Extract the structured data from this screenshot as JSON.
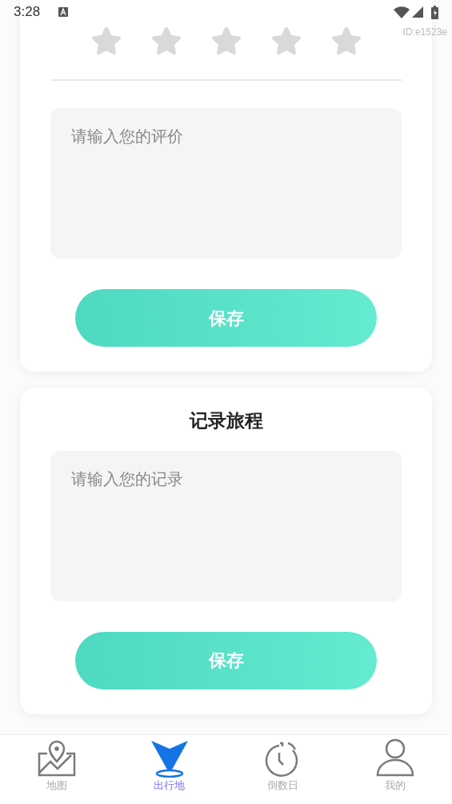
{
  "status_bar": {
    "time": "3:28",
    "overlay_id": "ID:e1523e"
  },
  "rating": {
    "stars": 0,
    "comment": {
      "placeholder": "请输入您的评价"
    },
    "save_button": "保存"
  },
  "journal": {
    "title": "记录旅程",
    "record": {
      "placeholder": "请输入您的记录"
    },
    "save_button": "保存"
  },
  "nav": [
    {
      "kind": "map",
      "label": "地图",
      "selected": false
    },
    {
      "kind": "place",
      "label": "出行地",
      "selected": true
    },
    {
      "kind": "countdown",
      "label": "倒数日",
      "selected": false
    },
    {
      "kind": "profile",
      "label": "我的",
      "selected": false
    }
  ]
}
